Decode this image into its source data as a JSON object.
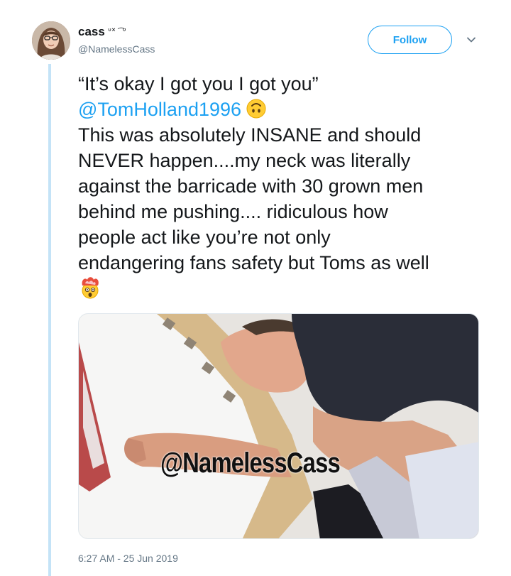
{
  "user": {
    "display_name": "cass",
    "name_decoration": "ᐡ˟ ͡ ᐡ",
    "handle": "@NamelessCass"
  },
  "follow_label": "Follow",
  "tweet": {
    "line1": "“It’s okay I got you I got you”",
    "mention": "@TomHolland1996",
    "lines": [
      "This was absolutely INSANE and should",
      "NEVER happen....my neck was literally",
      "against the barricade with 30 grown men",
      "behind me pushing....  ridiculous how",
      "people act like you’re not only",
      "endangering fans safety but Toms as well"
    ]
  },
  "media": {
    "watermark": "@NamelessCass"
  },
  "timestamp": "6:27 AM - 25 Jun 2019",
  "icons": {
    "emoji_1": "upside-down-face-emoji",
    "emoji_2": "exploding-head-emoji",
    "chevron": "chevron-down-icon"
  },
  "colors": {
    "accent": "#1da1f2",
    "secondary_text": "#657786",
    "thread_line": "#c4e3f7"
  }
}
